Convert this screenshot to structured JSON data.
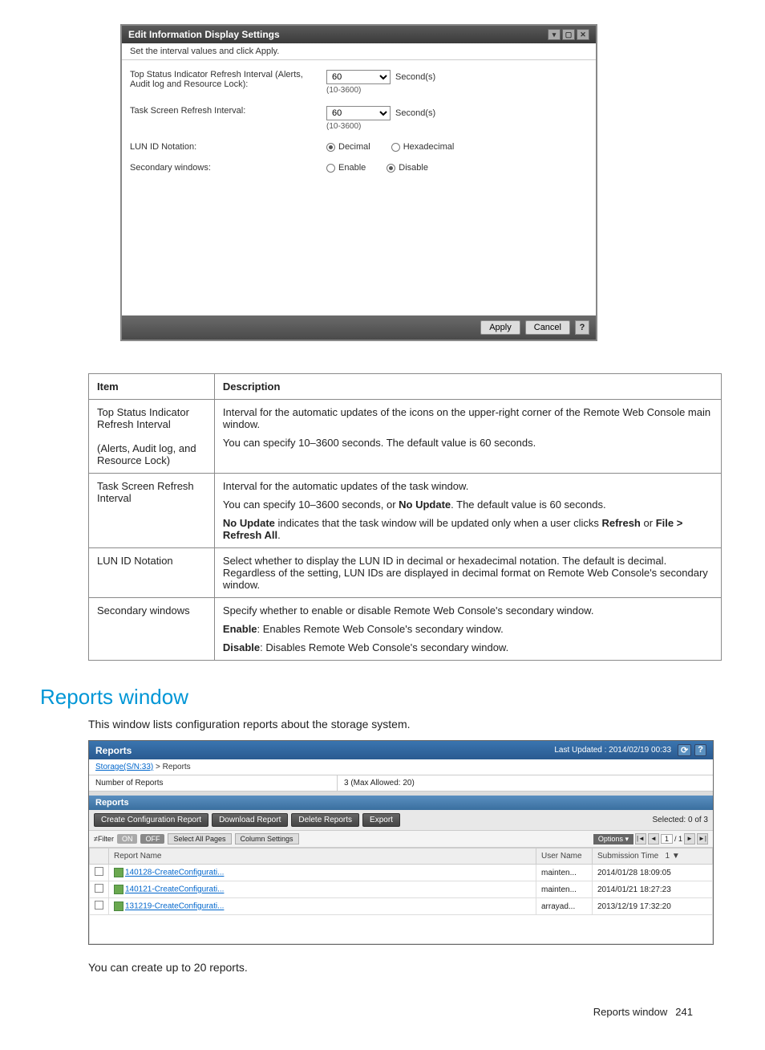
{
  "dialog": {
    "title": "Edit Information Display Settings",
    "subtitle": "Set the interval values and click Apply.",
    "row1": {
      "label": "Top Status Indicator Refresh Interval (Alerts, Audit log and Resource Lock):",
      "value": "60",
      "unit": "Second(s)",
      "range": "(10-3600)"
    },
    "row2": {
      "label": "Task Screen Refresh Interval:",
      "value": "60",
      "unit": "Second(s)",
      "range": "(10-3600)"
    },
    "row3": {
      "label": "LUN ID Notation:",
      "opt1": "Decimal",
      "opt2": "Hexadecimal"
    },
    "row4": {
      "label": "Secondary windows:",
      "opt1": "Enable",
      "opt2": "Disable"
    },
    "apply": "Apply",
    "cancel": "Cancel",
    "help": "?"
  },
  "descTable": {
    "hItem": "Item",
    "hDesc": "Description",
    "r1": {
      "item": "Top Status Indicator Refresh Interval",
      "sub": "(Alerts, Audit log, and Resource Lock)",
      "p1": "Interval for the automatic updates of the icons on the upper-right corner of the Remote Web Console main window.",
      "p2": "You can specify 10–3600 seconds. The default value is 60 seconds."
    },
    "r2": {
      "item": "Task Screen Refresh Interval",
      "p1": "Interval for the automatic updates of the task window.",
      "p2a": "You can specify 10–3600 seconds, or ",
      "p2b": "No Update",
      "p2c": ". The default value is 60 seconds.",
      "p3a": "No Update",
      "p3b": " indicates that the task window will be updated only when a user clicks ",
      "p3c": "Refresh",
      "p3d": " or ",
      "p3e": "File > Refresh All",
      "p3f": "."
    },
    "r3": {
      "item": "LUN ID Notation",
      "p1": "Select whether to display the LUN ID in decimal or hexadecimal notation. The default is decimal. Regardless of the setting, LUN IDs are displayed in decimal format on Remote Web Console's secondary window."
    },
    "r4": {
      "item": "Secondary windows",
      "p1": "Specify whether to enable or disable Remote Web Console's secondary window.",
      "p2a": "Enable",
      "p2b": ": Enables Remote Web Console's secondary window.",
      "p3a": "Disable",
      "p3b": ": Disables Remote Web Console's secondary window."
    }
  },
  "section": {
    "title": "Reports window",
    "intro": "This window lists configuration reports about the storage system.",
    "note": "You can create up to 20 reports."
  },
  "rwin": {
    "title": "Reports",
    "updated": "Last Updated : 2014/02/19 00:33",
    "bc_link": "Storage(S/N:33)",
    "bc_sep": " > ",
    "bc_cur": "Reports",
    "numLabel": "Number of Reports",
    "numVal": "3 (Max Allowed: 20)",
    "tabLabel": "Reports",
    "btnCreate": "Create Configuration Report",
    "btnDownload": "Download Report",
    "btnDelete": "Delete Reports",
    "btnExport": "Export",
    "selected": "Selected: 0   of 3",
    "filterLabel": "≠Filter",
    "on": "ON",
    "off": "OFF",
    "selAll": "Select All Pages",
    "colSet": "Column Settings",
    "options": "Options ▾",
    "pg1": "1",
    "pgSep": "/ 1",
    "colReport": "Report Name",
    "colUser": "User Name",
    "colTime": "Submission Time",
    "colTimeSort": "1 ▼",
    "rows": [
      {
        "name": "140128-CreateConfigurati...",
        "user": "mainten...",
        "time": "2014/01/28 18:09:05"
      },
      {
        "name": "140121-CreateConfigurati...",
        "user": "mainten...",
        "time": "2014/01/21 18:27:23"
      },
      {
        "name": "131219-CreateConfigurati...",
        "user": "arrayad...",
        "time": "2013/12/19 17:32:20"
      }
    ]
  },
  "footer": {
    "label": "Reports window",
    "page": "241"
  }
}
